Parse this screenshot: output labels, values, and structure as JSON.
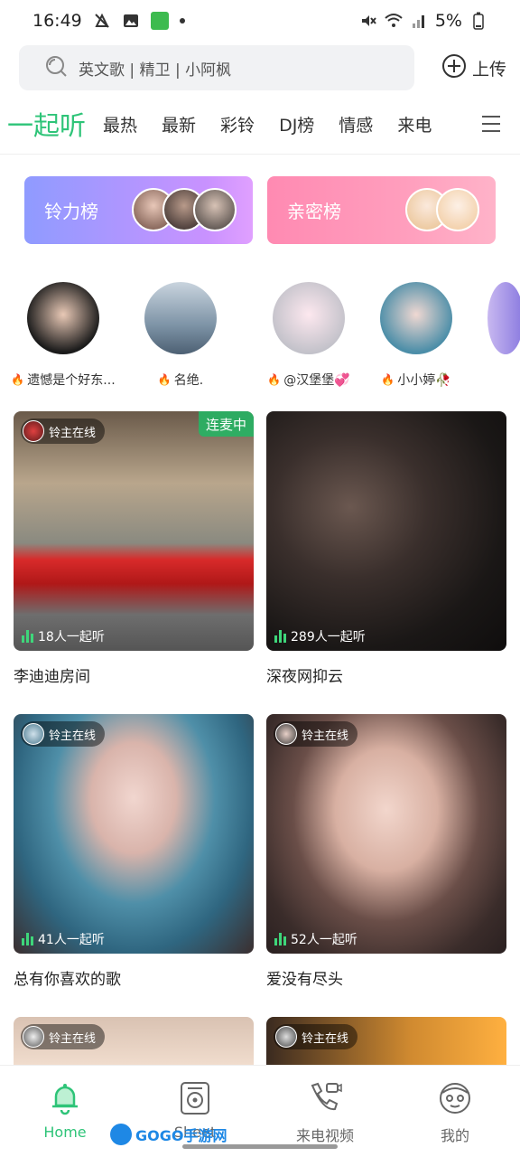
{
  "status": {
    "time": "16:49",
    "battery": "5%"
  },
  "search": {
    "placeholder": "英文歌 | 精卫 | 小阿枫",
    "upload_label": "上传"
  },
  "tabs": [
    {
      "label": "一起听",
      "active": true
    },
    {
      "label": "最热"
    },
    {
      "label": "最新"
    },
    {
      "label": "彩铃"
    },
    {
      "label": "DJ榜"
    },
    {
      "label": "情感"
    },
    {
      "label": "来电"
    }
  ],
  "rank_cards": [
    {
      "label": "铃力榜"
    },
    {
      "label": "亲密榜"
    }
  ],
  "anchors": [
    {
      "name": "遗憾是个好东..."
    },
    {
      "name": "名绝."
    },
    {
      "name": "@汉堡堡💞"
    },
    {
      "name": "小小婷🥀"
    }
  ],
  "rooms": [
    {
      "title": "李迪迪房间",
      "host_status": "铃主在线",
      "listeners": "18人一起听",
      "tag": "连麦中"
    },
    {
      "title": "深夜网抑云",
      "listeners": "289人一起听"
    },
    {
      "title": "总有你喜欢的歌",
      "host_status": "铃主在线",
      "listeners": "41人一起听"
    },
    {
      "title": "爱没有尽头",
      "host_status": "铃主在线",
      "listeners": "52人一起听"
    },
    {
      "host_status": "铃主在线"
    },
    {
      "host_status": "铃主在线"
    }
  ],
  "bottom_nav": [
    {
      "label": "Home",
      "active": true
    },
    {
      "label": "Sheet"
    },
    {
      "label": "来电视频"
    },
    {
      "label": "我的"
    }
  ],
  "watermark": {
    "text": "GOGO手游网"
  },
  "colors": {
    "accent": "#2ec478",
    "rank1": "#a99bff",
    "rank2": "#ff8fb6"
  }
}
